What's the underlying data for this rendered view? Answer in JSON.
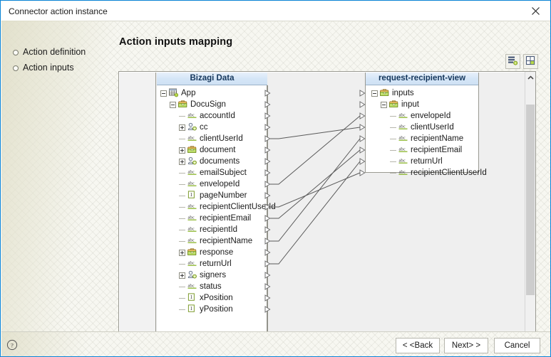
{
  "window": {
    "title": "Connector action instance",
    "close_icon": "close-icon"
  },
  "sidebar": {
    "items": [
      {
        "label": "Action definition",
        "icon": "circle-bullet-icon"
      },
      {
        "label": "Action inputs",
        "icon": "circle-bullet-icon"
      }
    ]
  },
  "main": {
    "title": "Action inputs mapping",
    "toolbar": [
      {
        "name": "auto-map-button",
        "icon": "auto-map-icon"
      },
      {
        "name": "layout-button",
        "icon": "layout-grid-icon"
      }
    ]
  },
  "mapper": {
    "source": {
      "header": "Bizagi Data",
      "rows": [
        {
          "label": "App",
          "indent": 0,
          "toggle": "minus",
          "icon": "entity-icon",
          "arrow": true
        },
        {
          "label": "DocuSign",
          "indent": 1,
          "toggle": "minus",
          "icon": "object-icon",
          "arrow": true
        },
        {
          "label": "accountId",
          "indent": 2,
          "toggle": "leaf",
          "icon": "string-icon",
          "arrow": true
        },
        {
          "label": "cc",
          "indent": 2,
          "toggle": "plus",
          "icon": "collection-icon",
          "arrow": true
        },
        {
          "label": "clientUserId",
          "indent": 2,
          "toggle": "leaf",
          "icon": "string-icon",
          "arrow": true
        },
        {
          "label": "document",
          "indent": 2,
          "toggle": "plus",
          "icon": "object-icon",
          "arrow": true
        },
        {
          "label": "documents",
          "indent": 2,
          "toggle": "plus",
          "icon": "collection-icon",
          "arrow": true
        },
        {
          "label": "emailSubject",
          "indent": 2,
          "toggle": "leaf",
          "icon": "string-icon",
          "arrow": true
        },
        {
          "label": "envelopeId",
          "indent": 2,
          "toggle": "leaf",
          "icon": "string-icon",
          "arrow": true
        },
        {
          "label": "pageNumber",
          "indent": 2,
          "toggle": "leaf",
          "icon": "number-icon",
          "arrow": true
        },
        {
          "label": "recipientClientUserId",
          "indent": 2,
          "toggle": "leaf",
          "icon": "string-icon",
          "arrow": true
        },
        {
          "label": "recipientEmail",
          "indent": 2,
          "toggle": "leaf",
          "icon": "string-icon",
          "arrow": true
        },
        {
          "label": "recipientId",
          "indent": 2,
          "toggle": "leaf",
          "icon": "string-icon",
          "arrow": true
        },
        {
          "label": "recipientName",
          "indent": 2,
          "toggle": "leaf",
          "icon": "string-icon",
          "arrow": true
        },
        {
          "label": "response",
          "indent": 2,
          "toggle": "plus",
          "icon": "object-icon",
          "arrow": true
        },
        {
          "label": "returnUrl",
          "indent": 2,
          "toggle": "leaf",
          "icon": "string-icon",
          "arrow": true
        },
        {
          "label": "signers",
          "indent": 2,
          "toggle": "plus",
          "icon": "collection-icon",
          "arrow": true
        },
        {
          "label": "status",
          "indent": 2,
          "toggle": "leaf",
          "icon": "string-icon",
          "arrow": true
        },
        {
          "label": "xPosition",
          "indent": 2,
          "toggle": "leaf",
          "icon": "number-icon",
          "arrow": true
        },
        {
          "label": "yPosition",
          "indent": 2,
          "toggle": "leaf",
          "icon": "number-icon",
          "arrow": true
        }
      ]
    },
    "target": {
      "header": "request-recipient-view",
      "rows": [
        {
          "label": "inputs",
          "indent": 0,
          "toggle": "minus",
          "icon": "object-icon",
          "arrow": true
        },
        {
          "label": "input",
          "indent": 1,
          "toggle": "minus",
          "icon": "object-icon",
          "arrow": true
        },
        {
          "label": "envelopeId",
          "indent": 2,
          "toggle": "leaf",
          "icon": "string-icon",
          "arrow": true
        },
        {
          "label": "clientUserId",
          "indent": 2,
          "toggle": "leaf",
          "icon": "string-icon",
          "arrow": true
        },
        {
          "label": "recipientName",
          "indent": 2,
          "toggle": "leaf",
          "icon": "string-icon",
          "arrow": true
        },
        {
          "label": "recipientEmail",
          "indent": 2,
          "toggle": "leaf",
          "icon": "string-icon",
          "arrow": true
        },
        {
          "label": "returnUrl",
          "indent": 2,
          "toggle": "leaf",
          "icon": "string-icon",
          "arrow": true
        },
        {
          "label": "recipientClientUserId",
          "indent": 2,
          "toggle": "leaf",
          "icon": "string-icon",
          "arrow": true
        }
      ]
    },
    "links": [
      {
        "from": "clientUserId",
        "to": "clientUserId"
      },
      {
        "from": "envelopeId",
        "to": "envelopeId"
      },
      {
        "from": "recipientClientUserId",
        "to": "recipientClientUserId"
      },
      {
        "from": "recipientEmail",
        "to": "recipientEmail"
      },
      {
        "from": "recipientName",
        "to": "recipientName"
      },
      {
        "from": "returnUrl",
        "to": "returnUrl"
      }
    ],
    "scrollbar": {
      "up_icon": "chevron-up-icon",
      "down_icon": "chevron-down-icon"
    }
  },
  "footer": {
    "help_icon": "help-icon",
    "buttons": [
      {
        "name": "back-button",
        "label": "< <Back"
      },
      {
        "name": "next-button",
        "label": "Next> >"
      },
      {
        "name": "cancel-button",
        "label": "Cancel"
      }
    ]
  },
  "colors": {
    "window_border": "#0a84d8",
    "header_blue": "#cfe1f4",
    "canvas_grey": "#efefef",
    "link_line": "#5a5a5a"
  }
}
